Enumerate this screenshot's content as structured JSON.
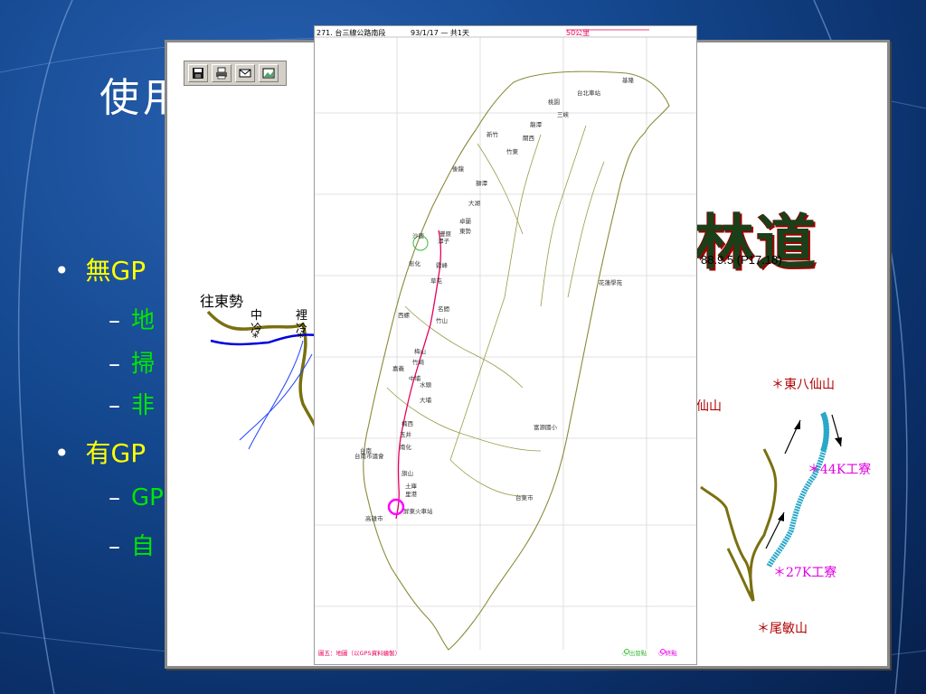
{
  "slide": {
    "title": "使用",
    "bullets": [
      {
        "label": "無GP",
        "subs": [
          "地",
          "掃",
          "非"
        ]
      },
      {
        "label": "有GP",
        "subs": [
          "GP",
          "自"
        ]
      }
    ],
    "bullet_symbol": "•",
    "sub_symbol": "–",
    "colors": {
      "bullet": "#ffff00",
      "sub": "#00e600",
      "title": "#ffffff"
    }
  },
  "back_window": {
    "toolbar_icons": [
      "save-icon",
      "print-icon",
      "mail-icon",
      "picture-icon"
    ],
    "title_text": "林道",
    "date_ref": "88.9.5 (P17.18)",
    "labels": {
      "to_dongshi": "往東勢",
      "zhong": "中",
      "leng1": "冷",
      "li": "裡",
      "leng2": "冷",
      "star1": "*",
      "star2": "*",
      "xianshan": "仙山",
      "east_xianshan": "＊東八仙山",
      "k44": "＊44K工寮",
      "k27": "＊27K工寮",
      "weimin": "＊尾敏山"
    }
  },
  "front_window": {
    "header_title": "271. 台三線公路南段",
    "header_date": "93/1/17 — 共1天",
    "header_scale": "50公里",
    "cities": [
      {
        "name": "基隆"
      },
      {
        "name": "台北車站"
      },
      {
        "name": "桃園"
      },
      {
        "name": "三峽"
      },
      {
        "name": "龍潭"
      },
      {
        "name": "新竹"
      },
      {
        "name": "關西"
      },
      {
        "name": "竹東"
      },
      {
        "name": "後龍"
      },
      {
        "name": "獅潭"
      },
      {
        "name": "大湖"
      },
      {
        "name": "卓蘭"
      },
      {
        "name": "東勢"
      },
      {
        "name": "沙鹿"
      },
      {
        "name": "豐原"
      },
      {
        "name": "潭子"
      },
      {
        "name": "彰化"
      },
      {
        "name": "霧峰"
      },
      {
        "name": "草屯"
      },
      {
        "name": "名間"
      },
      {
        "name": "竹山"
      },
      {
        "name": "西螺"
      },
      {
        "name": "梅山"
      },
      {
        "name": "竹崎"
      },
      {
        "name": "嘉義"
      },
      {
        "name": "中埔"
      },
      {
        "name": "水頭"
      },
      {
        "name": "大埔"
      },
      {
        "name": "楠西"
      },
      {
        "name": "玉井"
      },
      {
        "name": "南化"
      },
      {
        "name": "旗山"
      },
      {
        "name": "台南市議會"
      },
      {
        "name": "台南"
      },
      {
        "name": "土庫"
      },
      {
        "name": "里港"
      },
      {
        "name": "屏東火車站"
      },
      {
        "name": "高雄市"
      },
      {
        "name": "台東市"
      },
      {
        "name": "花蓮學苑"
      },
      {
        "name": "富源國小"
      }
    ],
    "footer_left": "圖五：地圖（以GPS資料繪製）",
    "footer_start": "○ 出發點",
    "footer_end": "○ 終點",
    "colors": {
      "route": "#e8005a",
      "coast": "#8a8a3a",
      "circle": "#ff00ff"
    }
  }
}
